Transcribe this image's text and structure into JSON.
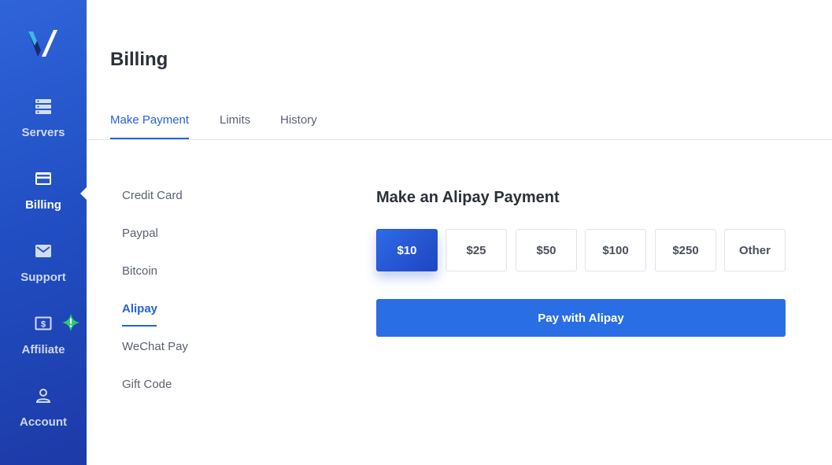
{
  "sidebar": {
    "items": [
      {
        "label": "Servers",
        "icon": "servers-icon"
      },
      {
        "label": "Billing",
        "icon": "credit-card-icon",
        "active": true
      },
      {
        "label": "Support",
        "icon": "envelope-icon"
      },
      {
        "label": "Affiliate",
        "icon": "dollar-bill-icon",
        "badge": "alert-icon"
      },
      {
        "label": "Account",
        "icon": "user-icon"
      }
    ]
  },
  "header": {
    "title": "Billing",
    "tabs": [
      {
        "label": "Make Payment",
        "active": true
      },
      {
        "label": "Limits"
      },
      {
        "label": "History"
      }
    ]
  },
  "payment_methods": [
    {
      "label": "Credit Card"
    },
    {
      "label": "Paypal"
    },
    {
      "label": "Bitcoin"
    },
    {
      "label": "Alipay",
      "active": true
    },
    {
      "label": "WeChat Pay"
    },
    {
      "label": "Gift Code"
    }
  ],
  "panel": {
    "title": "Make an Alipay Payment",
    "amounts": [
      {
        "label": "$10",
        "selected": true
      },
      {
        "label": "$25"
      },
      {
        "label": "$50"
      },
      {
        "label": "$100"
      },
      {
        "label": "$250"
      },
      {
        "label": "Other"
      }
    ],
    "pay_button": "Pay with Alipay"
  },
  "colors": {
    "accent": "#2563d8",
    "sidebar_top": "#2f64d8",
    "sidebar_bottom": "#1d3aa8",
    "alert": "#2ecc71"
  }
}
